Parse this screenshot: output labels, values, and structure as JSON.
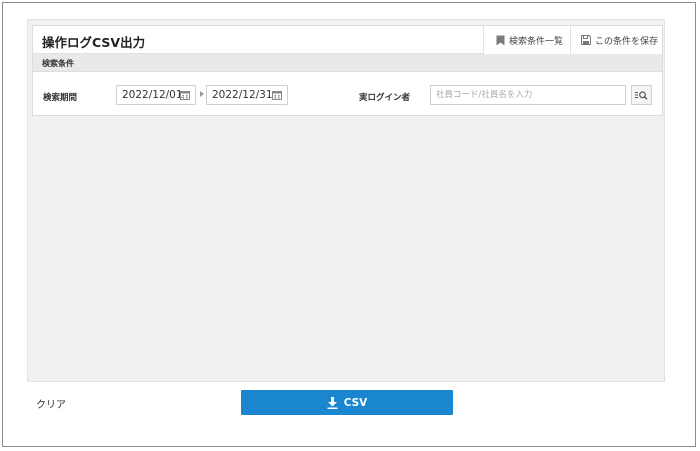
{
  "page": {
    "title": "操作ログCSV出力",
    "header_buttons": {
      "list_label": "検索条件一覧",
      "save_label": "この条件を保存"
    }
  },
  "conditions": {
    "section_label": "検索条件",
    "period": {
      "label": "検索期間",
      "start_value": "2022/12/01",
      "end_value": "2022/12/31"
    },
    "login_user": {
      "label": "実ログイン者",
      "placeholder": "社員コード/社員名を入力"
    }
  },
  "footer": {
    "clear_label": "クリア",
    "csv_label": "CSV"
  },
  "icons": {
    "list": "bookmark-icon",
    "save": "floppy-disk-icon",
    "calendar": "calendar-icon",
    "search": "search-list-icon",
    "download": "download-icon"
  },
  "colors": {
    "primary": "#1a86cf",
    "background_area": "#f1f1f1",
    "condition_bar": "#e9e9e9"
  }
}
